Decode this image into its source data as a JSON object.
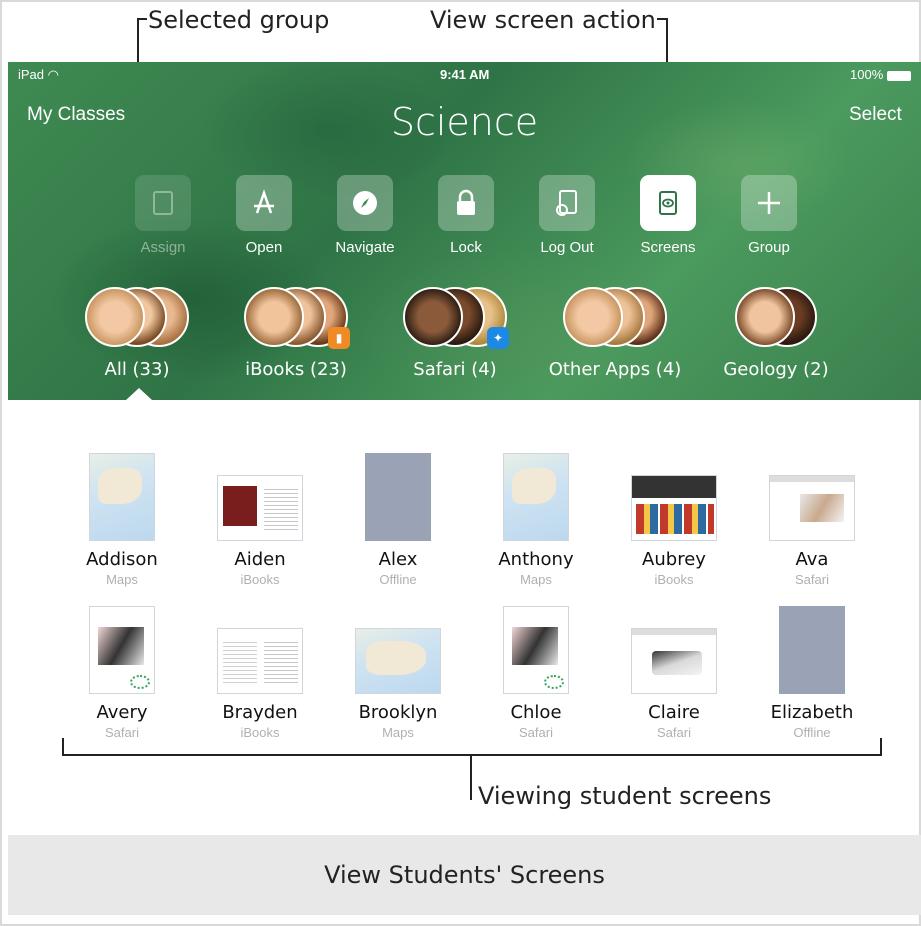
{
  "callouts": {
    "selected_group": "Selected group",
    "view_screen_action": "View screen action",
    "viewing_student_screens": "Viewing student screens"
  },
  "status_bar": {
    "device": "iPad",
    "time": "9:41 AM",
    "battery": "100%"
  },
  "nav": {
    "back": "My Classes",
    "title": "Science",
    "select": "Select"
  },
  "actions": [
    {
      "label": "Assign",
      "icon": "assign-icon"
    },
    {
      "label": "Open",
      "icon": "app-store-icon"
    },
    {
      "label": "Navigate",
      "icon": "compass-icon"
    },
    {
      "label": "Lock",
      "icon": "lock-icon"
    },
    {
      "label": "Log Out",
      "icon": "log-out-icon"
    },
    {
      "label": "Screens",
      "icon": "eye-icon",
      "active": true
    },
    {
      "label": "Group",
      "icon": "plus-icon"
    }
  ],
  "groups": [
    {
      "label": "All (33)",
      "selected": true
    },
    {
      "label": "iBooks (23)",
      "badge": "ibooks-icon"
    },
    {
      "label": "Safari (4)",
      "badge": "safari-icon"
    },
    {
      "label": "Other Apps (4)"
    },
    {
      "label": "Geology (2)"
    }
  ],
  "students": [
    {
      "name": "Addison",
      "app": "Maps"
    },
    {
      "name": "Aiden",
      "app": "iBooks"
    },
    {
      "name": "Alex",
      "app": "Offline"
    },
    {
      "name": "Anthony",
      "app": "Maps"
    },
    {
      "name": "Aubrey",
      "app": "iBooks"
    },
    {
      "name": "Ava",
      "app": "Safari"
    },
    {
      "name": "Avery",
      "app": "Safari"
    },
    {
      "name": "Brayden",
      "app": "iBooks"
    },
    {
      "name": "Brooklyn",
      "app": "Maps"
    },
    {
      "name": "Chloe",
      "app": "Safari"
    },
    {
      "name": "Claire",
      "app": "Safari"
    },
    {
      "name": "Elizabeth",
      "app": "Offline"
    }
  ],
  "caption": "View Students' Screens",
  "colors": {
    "header_green": "#2f7446",
    "offline_gray": "#9aa3b5",
    "badge_orange": "#f08a24",
    "badge_blue": "#1e88e5"
  }
}
